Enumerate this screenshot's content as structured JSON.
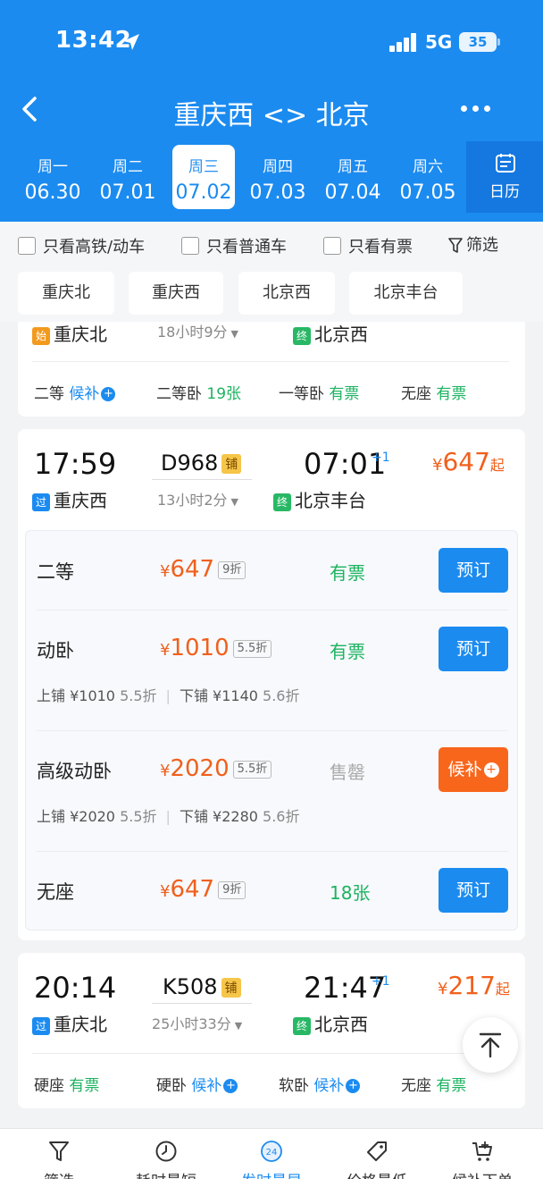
{
  "status": {
    "time": "13:42",
    "network": "5G",
    "battery": "35"
  },
  "nav": {
    "title": "重庆西 <> 北京"
  },
  "dates": [
    {
      "weekday": "周一",
      "date": "06.30"
    },
    {
      "weekday": "周二",
      "date": "07.01"
    },
    {
      "weekday": "周三",
      "date": "07.02",
      "selected": true
    },
    {
      "weekday": "周四",
      "date": "07.03"
    },
    {
      "weekday": "周五",
      "date": "07.04"
    },
    {
      "weekday": "周六",
      "date": "07.05"
    }
  ],
  "calendar_label": "日历",
  "filters": {
    "hsr": "只看高铁/动车",
    "normal": "只看普通车",
    "available": "只看有票",
    "filter": "筛选"
  },
  "stations": [
    "重庆北",
    "重庆西",
    "北京西",
    "北京丰台"
  ],
  "train_partial": {
    "dep_station": "重庆北",
    "dep_badge": "始",
    "duration": "18小时9分",
    "arr_station": "北京西",
    "arr_badge": "终",
    "seats": [
      {
        "name": "二等",
        "status": "候补"
      },
      {
        "name": "二等卧",
        "status": "19张"
      },
      {
        "name": "一等卧",
        "status": "有票"
      },
      {
        "name": "无座",
        "status": "有票"
      }
    ]
  },
  "train_d968": {
    "dep_time": "17:59",
    "train_no": "D968",
    "tag": "铺",
    "arr_time": "07:01",
    "day_plus": "+1",
    "price": "647",
    "price_suffix": "起",
    "currency": "¥",
    "dep_badge": "过",
    "dep_station": "重庆西",
    "duration": "13小时2分",
    "arr_badge": "终",
    "arr_station": "北京丰台",
    "seats": [
      {
        "name": "二等",
        "price": "647",
        "discount": "9折",
        "status": "有票",
        "button": "预订"
      },
      {
        "name": "动卧",
        "price": "1010",
        "discount": "5.5折",
        "status": "有票",
        "button": "预订",
        "upper": "上铺 ¥1010",
        "upper_disc": "5.5折",
        "lower": "下铺 ¥1140",
        "lower_disc": "5.6折"
      },
      {
        "name": "高级动卧",
        "price": "2020",
        "discount": "5.5折",
        "status": "售罄",
        "button": "候补",
        "upper": "上铺 ¥2020",
        "upper_disc": "5.5折",
        "lower": "下铺 ¥2280",
        "lower_disc": "5.6折"
      },
      {
        "name": "无座",
        "price": "647",
        "discount": "9折",
        "status": "18张",
        "button": "预订"
      }
    ]
  },
  "train_k508": {
    "dep_time": "20:14",
    "train_no": "K508",
    "tag": "铺",
    "arr_time": "21:47",
    "day_plus": "+1",
    "price": "217",
    "price_suffix": "起",
    "currency": "¥",
    "dep_badge": "过",
    "dep_station": "重庆北",
    "duration": "25小时33分",
    "arr_badge": "终",
    "arr_station": "北京西",
    "seats": [
      {
        "name": "硬座",
        "status": "有票"
      },
      {
        "name": "硬卧",
        "status": "候补"
      },
      {
        "name": "软卧",
        "status": "候补"
      },
      {
        "name": "无座",
        "status": "有票"
      }
    ]
  },
  "tabs": [
    {
      "label": "筛选",
      "icon": "filter-icon"
    },
    {
      "label": "耗时最短",
      "icon": "clock-icon"
    },
    {
      "label": "发时最早",
      "icon": "hour24-icon",
      "active": true
    },
    {
      "label": "价格最低",
      "icon": "price-tag-icon"
    },
    {
      "label": "候补下单",
      "icon": "cart-icon"
    }
  ],
  "colors": {
    "brand": "#1b8bf0",
    "price": "#f0601c",
    "available": "#1cb360",
    "waitlist_button": "#f8661c"
  }
}
